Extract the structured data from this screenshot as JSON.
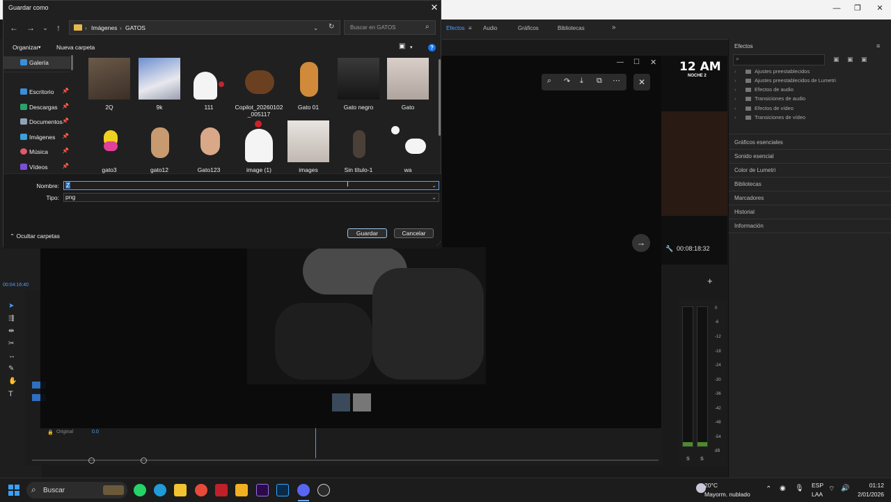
{
  "premiere": {
    "workspace_tabs": [
      "Efectos",
      "Audio",
      "Gráficos",
      "Bibliotecas"
    ],
    "program_time": "00:08:18:32",
    "clock_overlay": {
      "time": "12 AM",
      "sub": "NOCHE 2"
    },
    "left_timecode": "00:04:16:40",
    "effects_panel": {
      "title": "Efectos",
      "tree": [
        "Ajustes preestablecidos",
        "Ajustes preestablecidos de Lumetri",
        "Efectos de audio",
        "Transiciones de audio",
        "Efectos de vídeo",
        "Transiciones de vídeo"
      ],
      "sections": [
        "Gráficos esenciales",
        "Sonido esencial",
        "Color de Lumetri",
        "Bibliotecas",
        "Marcadores",
        "Historial",
        "Información"
      ]
    },
    "meter_labels": [
      "0",
      "-6",
      "-12",
      "-18",
      "-24",
      "-30",
      "-36",
      "-42",
      "-48",
      "-54",
      "dB"
    ],
    "meter_solo": [
      "S",
      "S"
    ],
    "timeline_original_label": "Original",
    "timeline_original_value": "0.0"
  },
  "dialog": {
    "title": "Guardar como",
    "breadcrumb": [
      "Imágenes",
      "GATOS"
    ],
    "search_placeholder": "Buscar en GATOS",
    "organize": "Organizar",
    "new_folder": "Nueva carpeta",
    "sidebar": [
      {
        "label": "Galería",
        "color": "#3b8fd9",
        "selected": true
      },
      {
        "label": "Escritorio",
        "color": "#3b8fd9",
        "pinned": true
      },
      {
        "label": "Descargas",
        "color": "#2aa26b",
        "pinned": true
      },
      {
        "label": "Documentos",
        "color": "#8fa3b8",
        "pinned": true
      },
      {
        "label": "Imágenes",
        "color": "#3ba0d9",
        "pinned": true
      },
      {
        "label": "Música",
        "color": "#e05a6b",
        "pinned": true
      },
      {
        "label": "Vídeos",
        "color": "#7a4fd6",
        "pinned": true
      }
    ],
    "files": [
      "2Q",
      "9k",
      "111",
      "Copilot_20260102 _005117",
      "Gato 01",
      "Gato negro",
      "Gato",
      "gato3",
      "gato12",
      "Gato123",
      "image (1)",
      "images",
      "Sin título-1",
      "wa"
    ],
    "name_label": "Nombre:",
    "name_value": "Z",
    "type_label": "Tipo:",
    "type_value": "png",
    "hide_folders": "Ocultar carpetas",
    "save": "Guardar",
    "cancel": "Cancelar"
  },
  "taskbar": {
    "search": "Buscar",
    "weather_temp": "20°C",
    "weather_desc": "Mayorm. nublado",
    "lang_1": "ESP",
    "lang_2": "LAA",
    "time": "01:12",
    "date": "2/01/2026"
  }
}
